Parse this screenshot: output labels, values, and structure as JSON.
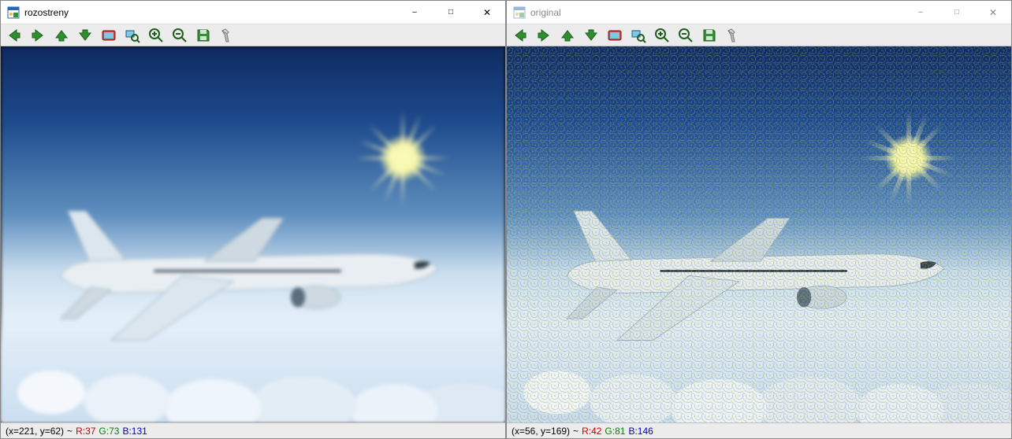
{
  "windows": [
    {
      "id": "left",
      "title": "rozostreny",
      "active": true,
      "status": {
        "coords": "(x=221, y=62)",
        "sep": "~",
        "r": "R:37",
        "g": "G:73",
        "b": "B:131"
      }
    },
    {
      "id": "right",
      "title": "original",
      "active": false,
      "status": {
        "coords": "(x=56, y=169)",
        "sep": "~",
        "r": "R:42",
        "g": "G:81",
        "b": "B:146"
      }
    }
  ],
  "icons": {
    "app": "image-icon",
    "back": "arrow-left-icon",
    "forward": "arrow-right-icon",
    "up": "arrow-up-icon",
    "down": "arrow-down-icon",
    "fit": "fit-window-icon",
    "zoom_region": "zoom-region-icon",
    "zoom_in": "zoom-in-icon",
    "zoom_out": "zoom-out-icon",
    "save": "save-icon",
    "flash": "flashlight-icon"
  },
  "image": {
    "subject": "airplane",
    "left_style": "blurred",
    "right_style": "noisy"
  }
}
